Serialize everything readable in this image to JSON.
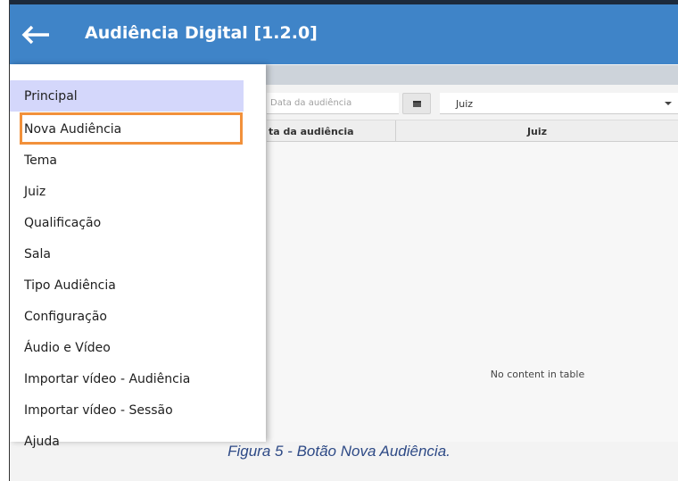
{
  "app": {
    "title": "Audiência Digital [1.2.0]",
    "accent_color": "#3f84c8",
    "back_icon": "arrow-left-icon"
  },
  "filters": {
    "date_placeholder": "Data da audiência",
    "calendar_icon": "calendar-icon",
    "judge_value": "Juiz"
  },
  "table": {
    "columns": [
      "ta da audiência",
      "Juiz"
    ],
    "empty_message": "No content in table"
  },
  "menu": {
    "items": [
      {
        "label": "Principal",
        "active": true
      },
      {
        "label": "Nova Audiência",
        "highlighted": true
      },
      {
        "label": "Tema"
      },
      {
        "label": "Juiz"
      },
      {
        "label": "Qualificação"
      },
      {
        "label": "Sala"
      },
      {
        "label": "Tipo Audiência"
      },
      {
        "label": "Configuração"
      },
      {
        "label": "Áudio e Vídeo"
      },
      {
        "label": "Importar vídeo - Audiência"
      },
      {
        "label": "Importar vídeo - Sessão"
      },
      {
        "label": "Ajuda"
      }
    ],
    "active_color": "#d4d7fb",
    "highlight_color": "#f2913b"
  },
  "caption": "Figura 5 - Botão Nova Audiência."
}
